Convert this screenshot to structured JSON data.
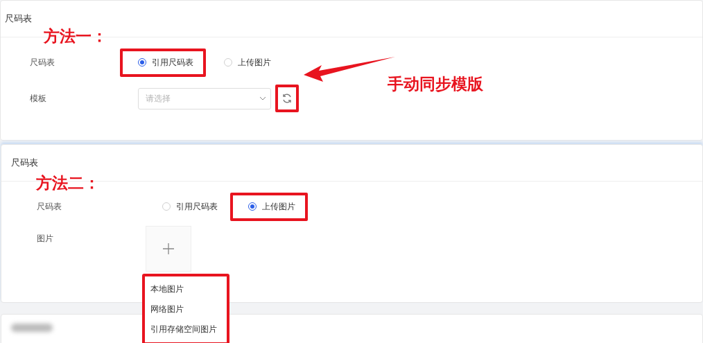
{
  "sections": [
    {
      "kind": "form",
      "title": "尺码表",
      "annotation": "方法一：",
      "fields": [
        {
          "kind": "radio",
          "label": "尺码表",
          "options": [
            {
              "label": "引用尺码表",
              "selected": true,
              "highlighted": true
            },
            {
              "label": "上传图片",
              "selected": false,
              "highlighted": false
            }
          ]
        },
        {
          "kind": "select",
          "label": "模板",
          "placeholder": "请选择",
          "sync_highlighted": true,
          "callout": "手动同步模版"
        }
      ]
    },
    {
      "kind": "form",
      "title": "尺码表",
      "annotation": "方法二：",
      "fields": [
        {
          "kind": "radio",
          "label": "尺码表",
          "options": [
            {
              "label": "引用尺码表",
              "selected": false,
              "highlighted": false
            },
            {
              "label": "上传图片",
              "selected": true,
              "highlighted": true
            }
          ]
        },
        {
          "kind": "upload",
          "label": "图片",
          "menu": {
            "highlighted": true,
            "items": [
              "本地图片",
              "网络图片",
              "引用存储空间图片"
            ]
          }
        }
      ]
    },
    {
      "kind": "blurred"
    }
  ]
}
